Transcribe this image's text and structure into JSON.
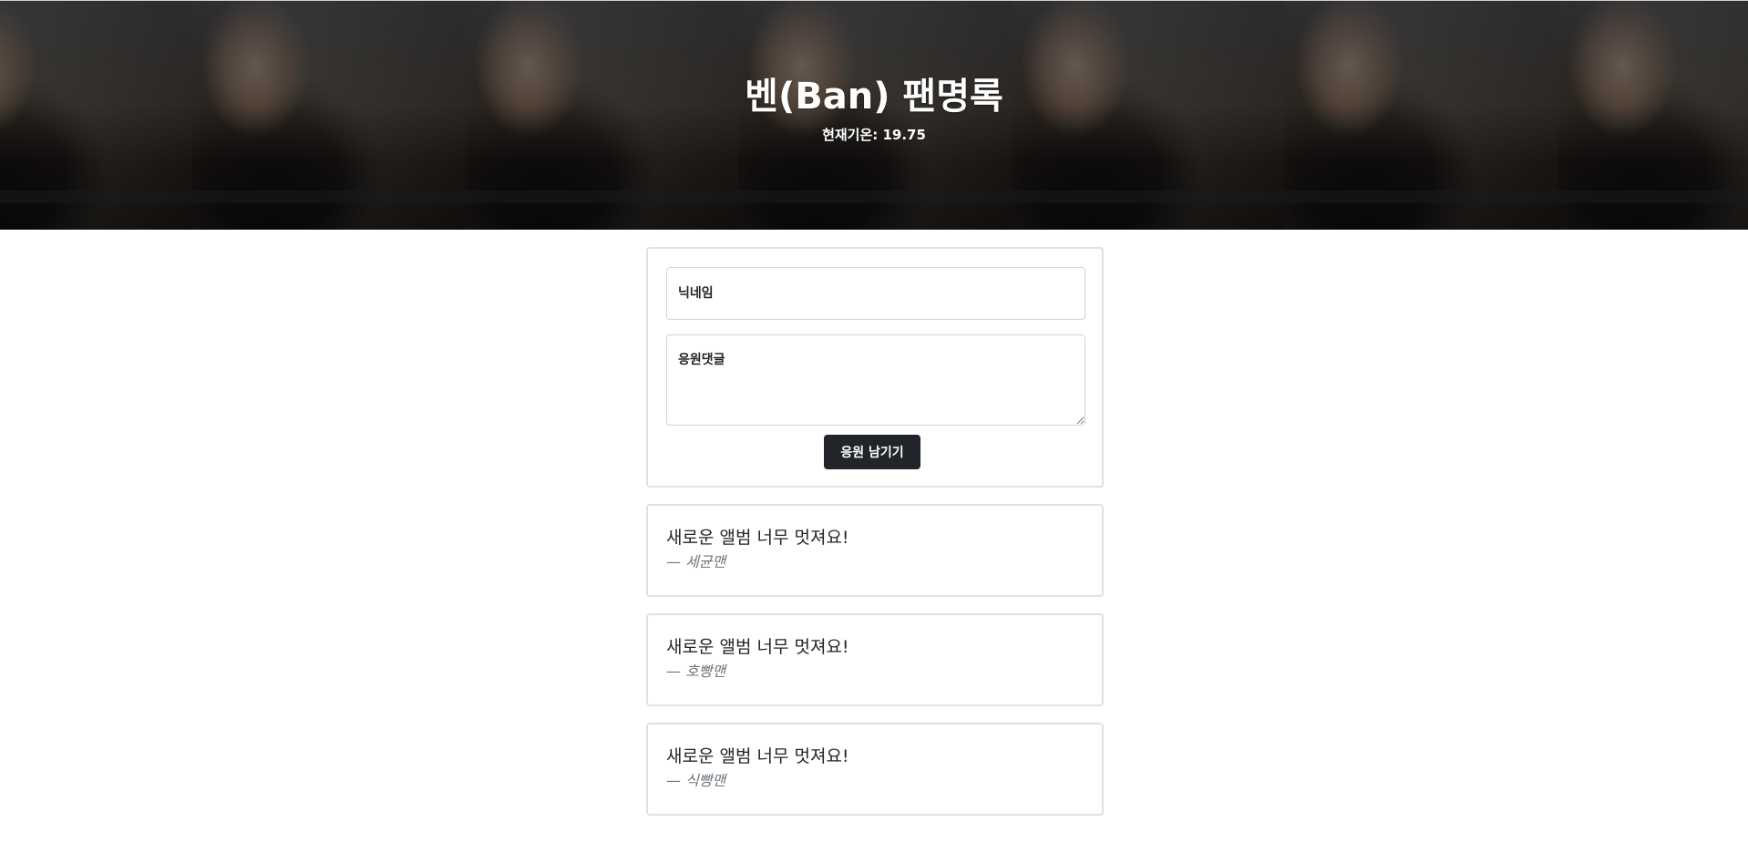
{
  "header": {
    "title": "벤(Ban) 팬명록",
    "temperature": "현재기온: 19.75"
  },
  "form": {
    "nickname_placeholder": "닉네임",
    "comment_placeholder": "응원댓글",
    "submit_label": "응원 남기기"
  },
  "comments": [
    {
      "text": "새로운 앨범 너무 멋져요!",
      "author": "— 세균맨"
    },
    {
      "text": "새로운 앨범 너무 멋져요!",
      "author": "— 호빵맨"
    },
    {
      "text": "새로운 앨범 너무 멋져요!",
      "author": "— 식빵맨"
    }
  ]
}
